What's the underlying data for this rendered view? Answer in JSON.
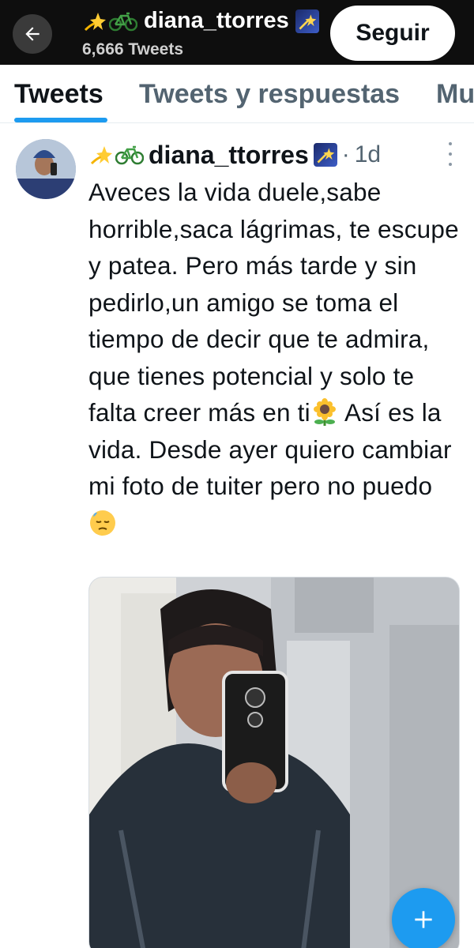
{
  "header": {
    "display_name": "diana_ttorres",
    "tweet_count": "6,666 Tweets",
    "follow_label": "Seguir"
  },
  "tabs": [
    {
      "label": "Tweets",
      "active": true
    },
    {
      "label": "Tweets y respuestas",
      "active": false
    },
    {
      "label": "Mu",
      "active": false
    }
  ],
  "tweet": {
    "display_name": "diana_ttorres",
    "separator": "·",
    "time": "1d",
    "text_part1": "Aveces la vida duele,sabe horrible,saca lágrimas, te escupe y patea. Pero más tarde y sin pedirlo,un amigo se toma el tiempo de decir que te admira, que tienes potencial y solo te falta creer más en ti",
    "text_part2": " Así es la vida. Desde ayer quiero cambiar mi foto de tuiter pero no puedo",
    "emoji_1": "sunflower-icon",
    "emoji_2": "downcast-sweat-face-icon",
    "name_emojis": [
      "dizzy-sparkle-icon",
      "bicycle-icon",
      "shooting-star-icon"
    ]
  },
  "colors": {
    "accent": "#1d9bf0",
    "header_bg": "#0e0e0e",
    "secondary_text": "#536471"
  }
}
